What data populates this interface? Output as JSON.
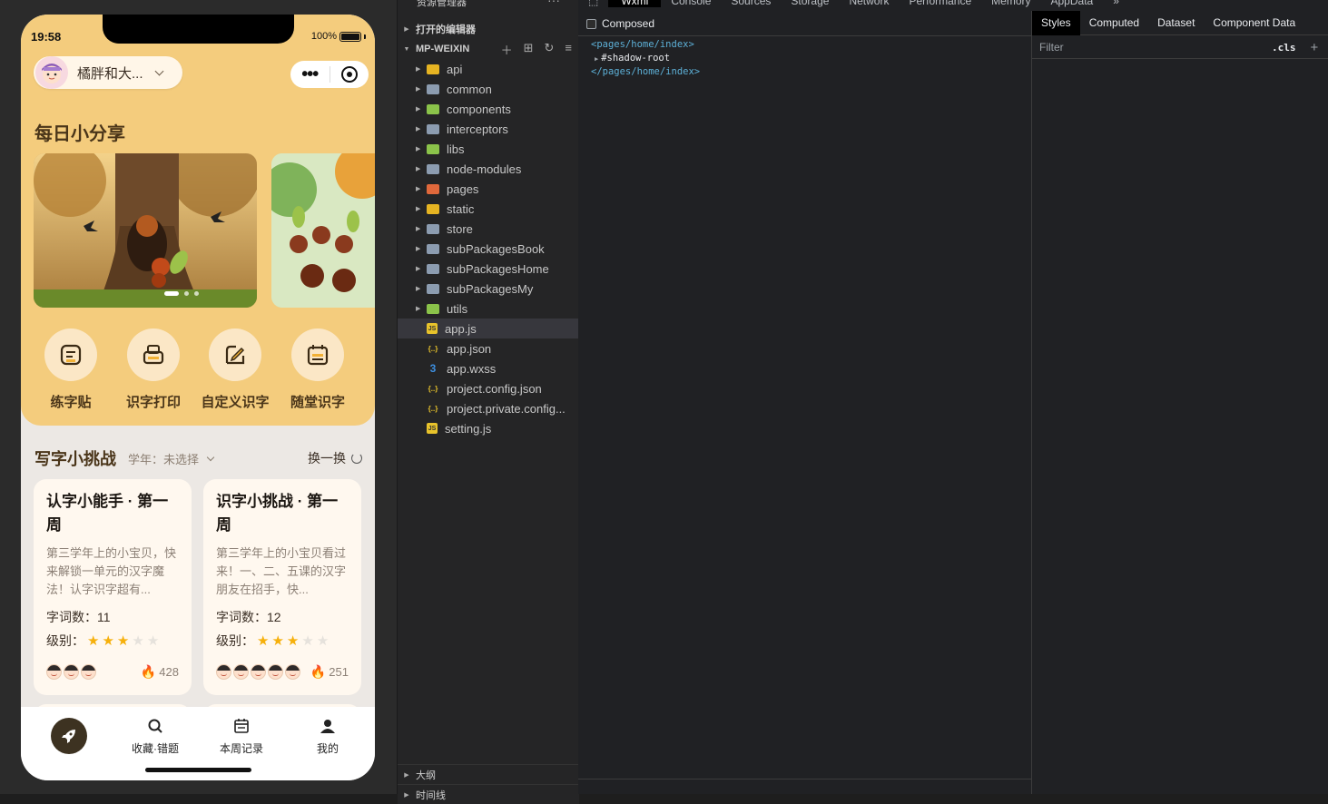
{
  "simulator": {
    "status_time": "19:58",
    "battery": "100%",
    "user_name": "橘胖和大...",
    "daily_title": "每日小分享",
    "quick_actions": [
      {
        "label": "练字贴",
        "icon": "notepad-icon"
      },
      {
        "label": "识字打印",
        "icon": "printer-icon"
      },
      {
        "label": "自定义识字",
        "icon": "edit-icon"
      },
      {
        "label": "随堂识字",
        "icon": "calendar-icon"
      }
    ],
    "challenge_title": "写字小挑战",
    "year_label": "学年：",
    "year_value": "未选择",
    "refresh_label": "换一换",
    "cards": [
      {
        "title": "认字小能手 · 第一周",
        "desc": "第三学年上的小宝贝，快来解锁一单元的汉字魔法！认字识字超有...",
        "count_label": "字词数：",
        "count": "11",
        "level_label": "级别：",
        "stars": 3,
        "faces": 3,
        "heat": "428"
      },
      {
        "title": "识字小挑战 · 第一周",
        "desc": "第三学年上的小宝贝看过来！一、二、五课的汉字朋友在招手，快...",
        "count_label": "字词数：",
        "count": "12",
        "level_label": "级别：",
        "stars": 3,
        "faces": 5,
        "heat": "251"
      }
    ],
    "tabs": [
      {
        "label": "收藏·错题",
        "icon": "search-icon"
      },
      {
        "label": "本周记录",
        "icon": "calendar-icon"
      },
      {
        "label": "我的",
        "icon": "user-icon"
      }
    ]
  },
  "explorer": {
    "title": "资源管理器",
    "open_editors": "打开的编辑器",
    "project": "MP-WEIXIN",
    "items": [
      {
        "name": "api",
        "type": "folder-y"
      },
      {
        "name": "common",
        "type": "folder"
      },
      {
        "name": "components",
        "type": "folder-g"
      },
      {
        "name": "interceptors",
        "type": "folder"
      },
      {
        "name": "libs",
        "type": "folder-g"
      },
      {
        "name": "node-modules",
        "type": "folder"
      },
      {
        "name": "pages",
        "type": "folder-r"
      },
      {
        "name": "static",
        "type": "folder-y"
      },
      {
        "name": "store",
        "type": "folder"
      },
      {
        "name": "subPackagesBook",
        "type": "folder"
      },
      {
        "name": "subPackagesHome",
        "type": "folder"
      },
      {
        "name": "subPackagesMy",
        "type": "folder"
      },
      {
        "name": "utils",
        "type": "folder-g"
      },
      {
        "name": "app.js",
        "type": "js"
      },
      {
        "name": "app.json",
        "type": "json"
      },
      {
        "name": "app.wxss",
        "type": "css"
      },
      {
        "name": "project.config.json",
        "type": "json"
      },
      {
        "name": "project.private.config...",
        "type": "json"
      },
      {
        "name": "setting.js",
        "type": "js"
      }
    ],
    "selected": "app.js",
    "outline": "大纲",
    "timeline": "时间线"
  },
  "devtools": {
    "tabs": [
      "Wxml",
      "Console",
      "Sources",
      "Storage",
      "Network",
      "Performance",
      "Memory",
      "AppData"
    ],
    "active_tab": "Wxml",
    "more": "»",
    "composed_label": "Composed",
    "code_open": "<pages/home/index>",
    "code_shadow": "#shadow-root",
    "code_close": "</pages/home/index>",
    "styles_tabs": [
      "Styles",
      "Computed",
      "Dataset",
      "Component Data"
    ],
    "active_styles_tab": "Styles",
    "filter_placeholder": "Filter",
    "cls_label": ".cls",
    "plus_label": "+"
  }
}
